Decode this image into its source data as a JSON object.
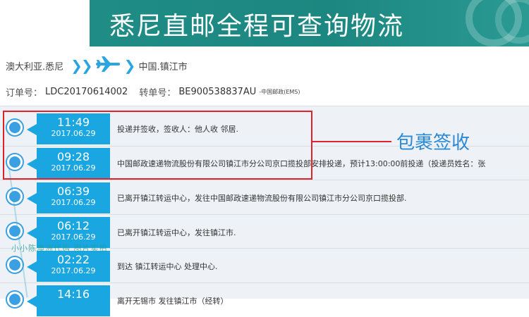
{
  "banner": {
    "title": "悉尼直邮全程可查询物流"
  },
  "route": {
    "origin": "澳大利亚.悉尼",
    "destination": "中国.镇江市"
  },
  "order": {
    "order_label": "订单号：",
    "order_no": "LDC20170614002",
    "transfer_label": "转单号：",
    "transfer_no": "BE900538837AU",
    "carrier": "-中国邮政(EMS)"
  },
  "timeline": [
    {
      "time": "11:49",
      "date": "2017.06.29",
      "desc": "投递并签收，签收人：他人收 邻居."
    },
    {
      "time": "09:28",
      "date": "2017.06.29",
      "desc": "中国邮政速递物流股份有限公司镇江市分公司京口揽投部安排投递，预计13:00:00前投递（投递员姓名：张"
    },
    {
      "time": "06:39",
      "date": "2017.06.29",
      "desc": "已离开镇江转运中心，发往中国邮政速递物流股份有限公司镇江市分公司京口揽投部."
    },
    {
      "time": "06:12",
      "date": "2017.06.29",
      "desc": "已离开镇江转运中心，发往镇江市."
    },
    {
      "time": "02:22",
      "date": "2017.06.29",
      "desc": "到达 镇江转运中心 处理中心."
    },
    {
      "time": "14:16",
      "date": "",
      "desc": "离开无锡市 发往镇江市（经转）"
    }
  ],
  "highlight": {
    "label": "包裹签收"
  },
  "watermark": {
    "text": "小小陈澳洲代购 图片实拍"
  },
  "colors": {
    "banner": "#1f8c86",
    "badge": "#1aa6e0",
    "highlight": "#e0232a",
    "label": "#2a8ad6"
  }
}
